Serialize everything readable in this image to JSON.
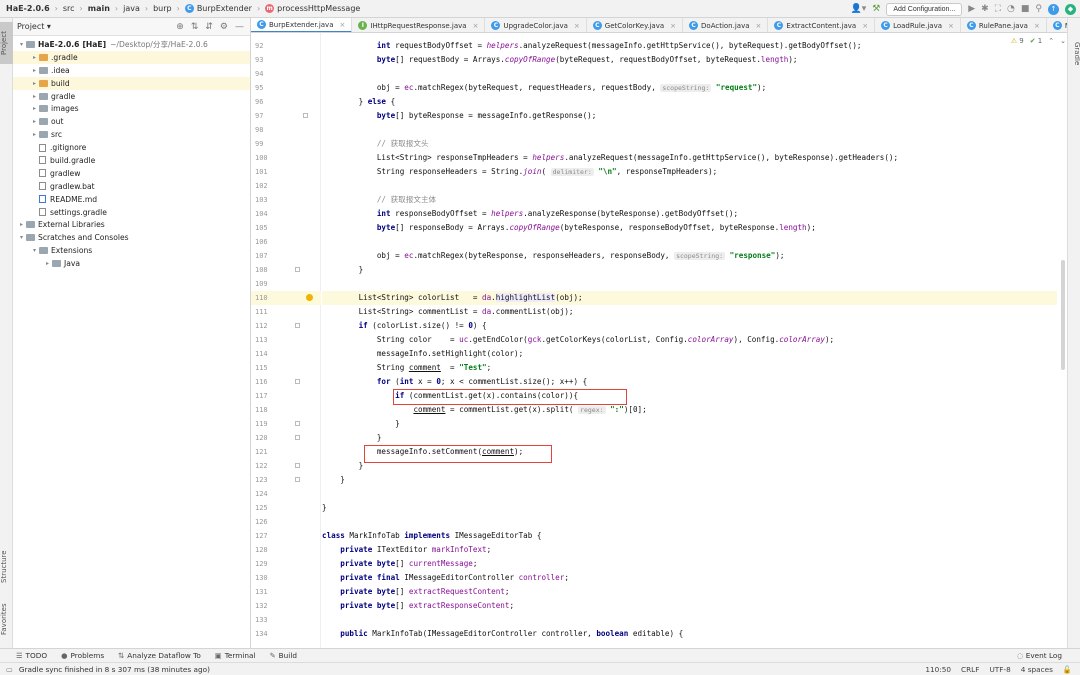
{
  "breadcrumb": [
    "HaE-2.0.6",
    "src",
    "main",
    "java",
    "burp",
    "BurpExtender",
    "processHttpMessage"
  ],
  "toolbar": {
    "add_config": "Add Configuration..."
  },
  "side_tabs": {
    "project": "Project",
    "structure": "Structure",
    "favorites": "Favorites",
    "gradle": "Gradle"
  },
  "project_panel": {
    "title": "Project",
    "tree": [
      {
        "label": "HaE-2.0.6",
        "bold": "[HaE]",
        "extra": "~/Desktop/分享/HaE-2.0.6",
        "depth": 0,
        "arrow": "▾",
        "kind": "folder"
      },
      {
        "label": ".gradle",
        "depth": 1,
        "arrow": "▸",
        "kind": "folder-orange",
        "hl": true
      },
      {
        "label": ".idea",
        "depth": 1,
        "arrow": "▸",
        "kind": "folder"
      },
      {
        "label": "build",
        "depth": 1,
        "arrow": "▸",
        "kind": "folder-orange",
        "hl": true
      },
      {
        "label": "gradle",
        "depth": 1,
        "arrow": "▸",
        "kind": "folder"
      },
      {
        "label": "images",
        "depth": 1,
        "arrow": "▸",
        "kind": "folder"
      },
      {
        "label": "out",
        "depth": 1,
        "arrow": "▸",
        "kind": "folder"
      },
      {
        "label": "src",
        "depth": 1,
        "arrow": "▸",
        "kind": "folder"
      },
      {
        "label": ".gitignore",
        "depth": 1,
        "arrow": "",
        "kind": "file"
      },
      {
        "label": "build.gradle",
        "depth": 1,
        "arrow": "",
        "kind": "file"
      },
      {
        "label": "gradlew",
        "depth": 1,
        "arrow": "",
        "kind": "file"
      },
      {
        "label": "gradlew.bat",
        "depth": 1,
        "arrow": "",
        "kind": "file"
      },
      {
        "label": "README.md",
        "depth": 1,
        "arrow": "",
        "kind": "file-md"
      },
      {
        "label": "settings.gradle",
        "depth": 1,
        "arrow": "",
        "kind": "file"
      },
      {
        "label": "External Libraries",
        "depth": 0,
        "arrow": "▸",
        "kind": "folder"
      },
      {
        "label": "Scratches and Consoles",
        "depth": 0,
        "arrow": "▾",
        "kind": "folder"
      },
      {
        "label": "Extensions",
        "depth": 1,
        "arrow": "▾",
        "kind": "folder"
      },
      {
        "label": "Java",
        "depth": 2,
        "arrow": "▸",
        "kind": "folder"
      }
    ]
  },
  "tabs": [
    {
      "label": "BurpExtender.java",
      "icon": "c",
      "active": true
    },
    {
      "label": "IHttpRequestResponse.java",
      "icon": "i"
    },
    {
      "label": "UpgradeColor.java",
      "icon": "c"
    },
    {
      "label": "GetColorKey.java",
      "icon": "c"
    },
    {
      "label": "DoAction.java",
      "icon": "c"
    },
    {
      "label": "ExtractContent.java",
      "icon": "c"
    },
    {
      "label": "LoadRule.java",
      "icon": "c"
    },
    {
      "label": "RulePane.java",
      "icon": "c"
    },
    {
      "label": "MainUI.java",
      "icon": "c"
    }
  ],
  "editor_status": {
    "warnings": "9",
    "checks": "1"
  },
  "code": {
    "first_line": 92,
    "current_line": 110,
    "lines": [
      [
        [
          "            int ",
          "kw"
        ],
        [
          "requestBodyOffset = ",
          ""
        ],
        [
          "helpers",
          "fld"
        ],
        [
          ".analyzeRequest(messageInfo.getHttpService(), byteRequest).getBodyOffset();",
          ""
        ]
      ],
      [
        [
          "            byte",
          "kw"
        ],
        [
          "[] requestBody = Arrays.",
          ""
        ],
        [
          "copyOfRange",
          "fld"
        ],
        [
          "(byteRequest, requestBodyOffset, byteRequest.",
          ""
        ],
        [
          "length",
          "fn"
        ],
        [
          ");",
          ""
        ]
      ],
      [
        [
          "",
          ""
        ]
      ],
      [
        [
          "            obj = ",
          ""
        ],
        [
          "ec",
          "fn"
        ],
        [
          ".matchRegex(byteRequest, requestHeaders, requestBody, ",
          ""
        ],
        [
          "scopeString:",
          "hint"
        ],
        [
          " ",
          ""
        ],
        [
          "\"request\"",
          "str"
        ],
        [
          ");",
          ""
        ]
      ],
      [
        [
          "        } ",
          ""
        ],
        [
          "else",
          "kw"
        ],
        [
          " {",
          ""
        ]
      ],
      [
        [
          "            byte",
          "kw"
        ],
        [
          "[] byteResponse = messageInfo.getResponse();",
          ""
        ]
      ],
      [
        [
          "",
          ""
        ]
      ],
      [
        [
          "            // 获取报文头",
          "cm"
        ]
      ],
      [
        [
          "            List<String> responseTmpHeaders = ",
          ""
        ],
        [
          "helpers",
          "fld"
        ],
        [
          ".analyzeRequest(messageInfo.getHttpService(), byteResponse).getHeaders();",
          ""
        ]
      ],
      [
        [
          "            String responseHeaders = String.",
          ""
        ],
        [
          "join",
          "fld"
        ],
        [
          "( ",
          ""
        ],
        [
          "delimiter:",
          "hint"
        ],
        [
          " ",
          ""
        ],
        [
          "\"\\n\"",
          "str"
        ],
        [
          ", responseTmpHeaders);",
          ""
        ]
      ],
      [
        [
          "",
          ""
        ]
      ],
      [
        [
          "            // 获取报文主体",
          "cm"
        ]
      ],
      [
        [
          "            int ",
          "kw"
        ],
        [
          "responseBodyOffset = ",
          ""
        ],
        [
          "helpers",
          "fld"
        ],
        [
          ".analyzeResponse(byteResponse).getBodyOffset();",
          ""
        ]
      ],
      [
        [
          "            byte",
          "kw"
        ],
        [
          "[] responseBody = Arrays.",
          ""
        ],
        [
          "copyOfRange",
          "fld"
        ],
        [
          "(byteResponse, responseBodyOffset, byteResponse.",
          ""
        ],
        [
          "length",
          "fn"
        ],
        [
          ");",
          ""
        ]
      ],
      [
        [
          "",
          ""
        ]
      ],
      [
        [
          "            obj = ",
          ""
        ],
        [
          "ec",
          "fn"
        ],
        [
          ".matchRegex(byteResponse, responseHeaders, responseBody, ",
          ""
        ],
        [
          "scopeString:",
          "hint"
        ],
        [
          " ",
          ""
        ],
        [
          "\"response\"",
          "str"
        ],
        [
          ");",
          ""
        ]
      ],
      [
        [
          "        }",
          ""
        ]
      ],
      [
        [
          "",
          ""
        ]
      ],
      [
        [
          "        List<String> colorList   = ",
          ""
        ],
        [
          "da",
          "fn"
        ],
        [
          ".",
          ""
        ],
        [
          "highlightList",
          "hlv"
        ],
        [
          "(obj);",
          ""
        ]
      ],
      [
        [
          "        List<String> commentList = ",
          ""
        ],
        [
          "da",
          "fn"
        ],
        [
          ".commentList(obj);",
          ""
        ]
      ],
      [
        [
          "        if",
          "kw"
        ],
        [
          " (colorList.size() != ",
          ""
        ],
        [
          "0",
          "kw"
        ],
        [
          ") {",
          ""
        ]
      ],
      [
        [
          "            String color    = ",
          ""
        ],
        [
          "uc",
          "fn"
        ],
        [
          ".getEndColor(",
          ""
        ],
        [
          "gck",
          "fn"
        ],
        [
          ".getColorKeys(colorList, Config.",
          ""
        ],
        [
          "colorArray",
          "fld"
        ],
        [
          "), Config.",
          ""
        ],
        [
          "colorArray",
          "fld"
        ],
        [
          ");",
          ""
        ]
      ],
      [
        [
          "            messageInfo.setHighlight(color);",
          ""
        ]
      ],
      [
        [
          "            String ",
          ""
        ],
        [
          "comment",
          "ul"
        ],
        [
          "  = ",
          ""
        ],
        [
          "\"Test\"",
          "str"
        ],
        [
          ";",
          ""
        ]
      ],
      [
        [
          "            for",
          "kw"
        ],
        [
          " (",
          ""
        ],
        [
          "int",
          "kw"
        ],
        [
          " x = ",
          ""
        ],
        [
          "0",
          "kw"
        ],
        [
          "; x < commentList.size(); x++) {",
          ""
        ]
      ],
      [
        [
          "                if",
          "kw"
        ],
        [
          " (commentList.get(x).contains(color)){",
          ""
        ]
      ],
      [
        [
          "                    ",
          ""
        ],
        [
          "comment",
          "ul"
        ],
        [
          " = commentList.get(x).split( ",
          ""
        ],
        [
          "regex:",
          "hint"
        ],
        [
          " ",
          ""
        ],
        [
          "\":\"",
          "str"
        ],
        [
          ")[0];",
          ""
        ]
      ],
      [
        [
          "                }",
          ""
        ]
      ],
      [
        [
          "            }",
          ""
        ]
      ],
      [
        [
          "            messageInfo.setComment(",
          ""
        ],
        [
          "comment",
          "ul"
        ],
        [
          ");",
          ""
        ]
      ],
      [
        [
          "        }",
          ""
        ]
      ],
      [
        [
          "    }",
          ""
        ]
      ],
      [
        [
          "",
          ""
        ]
      ],
      [
        [
          "}",
          ""
        ]
      ],
      [
        [
          "",
          ""
        ]
      ],
      [
        [
          "class",
          "kw"
        ],
        [
          " MarkInfoTab ",
          ""
        ],
        [
          "implements",
          "kw"
        ],
        [
          " IMessageEditorTab {",
          ""
        ]
      ],
      [
        [
          "    private",
          "kw"
        ],
        [
          " ITextEditor ",
          ""
        ],
        [
          "markInfoText",
          "fn"
        ],
        [
          ";",
          ""
        ]
      ],
      [
        [
          "    private byte",
          "kw"
        ],
        [
          "[] ",
          ""
        ],
        [
          "currentMessage",
          "fn"
        ],
        [
          ";",
          ""
        ]
      ],
      [
        [
          "    private final",
          "kw"
        ],
        [
          " IMessageEditorController ",
          ""
        ],
        [
          "controller",
          "fn"
        ],
        [
          ";",
          ""
        ]
      ],
      [
        [
          "    private byte",
          "kw"
        ],
        [
          "[] ",
          ""
        ],
        [
          "extractRequestContent",
          "fn"
        ],
        [
          ";",
          ""
        ]
      ],
      [
        [
          "    private byte",
          "kw"
        ],
        [
          "[] ",
          ""
        ],
        [
          "extractResponseContent",
          "fn"
        ],
        [
          ";",
          ""
        ]
      ],
      [
        [
          "",
          ""
        ]
      ],
      [
        [
          "    public",
          "kw"
        ],
        [
          " MarkInfoTab(IMessageEditorController controller, ",
          ""
        ],
        [
          "boolean",
          "kw"
        ],
        [
          " editable) {",
          ""
        ]
      ]
    ]
  },
  "bottom_tools": [
    {
      "icon": "☰",
      "label": "TODO"
    },
    {
      "icon": "●",
      "label": "Problems"
    },
    {
      "icon": "⇅",
      "label": "Analyze Dataflow To"
    },
    {
      "icon": "▣",
      "label": "Terminal"
    },
    {
      "icon": "✎",
      "label": "Build"
    }
  ],
  "event_log": "Event Log",
  "status": {
    "message": "Gradle sync finished in 8 s 307 ms (38 minutes ago)",
    "position": "110:50",
    "line_sep": "CRLF",
    "encoding": "UTF-8",
    "indent": "4 spaces"
  },
  "colors": {
    "accent": "#4083c9",
    "highlight_box": "#e0443b",
    "current_line": "#fdf9dc"
  }
}
